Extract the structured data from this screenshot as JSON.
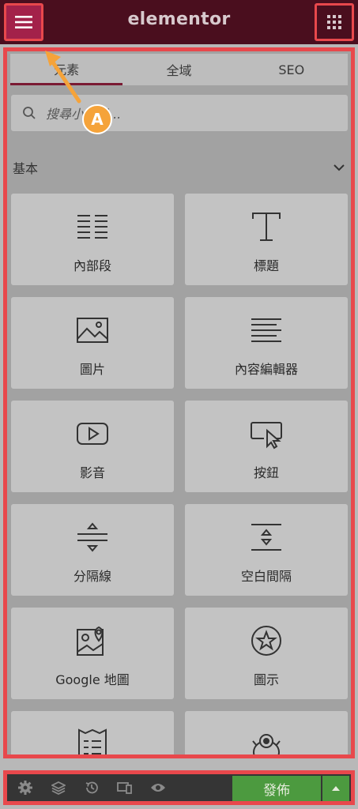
{
  "header": {
    "logo": "elementor",
    "menu_icon": "hamburger-icon",
    "apps_icon": "grid-icon"
  },
  "tabs": [
    {
      "label": "元素",
      "active": true
    },
    {
      "label": "全域",
      "active": false
    },
    {
      "label": "SEO",
      "active": false
    }
  ],
  "search": {
    "placeholder": "搜尋小工具..."
  },
  "section": {
    "title": "基本"
  },
  "widgets": [
    {
      "label": "內部段",
      "icon": "inner-section-icon"
    },
    {
      "label": "標題",
      "icon": "heading-icon"
    },
    {
      "label": "圖片",
      "icon": "image-icon"
    },
    {
      "label": "內容編輯器",
      "icon": "text-editor-icon"
    },
    {
      "label": "影音",
      "icon": "video-icon"
    },
    {
      "label": "按鈕",
      "icon": "button-icon"
    },
    {
      "label": "分隔線",
      "icon": "divider-icon"
    },
    {
      "label": "空白間隔",
      "icon": "spacer-icon"
    },
    {
      "label": "Google 地圖",
      "icon": "google-maps-icon"
    },
    {
      "label": "圖示",
      "icon": "star-icon"
    },
    {
      "label": "",
      "icon": "form-icon"
    },
    {
      "label": "",
      "icon": "monster-icon"
    }
  ],
  "annotation": {
    "badge": "A"
  },
  "footer": {
    "publish_label": "發佈",
    "icons": [
      "gear-icon",
      "layers-icon",
      "history-icon",
      "responsive-icon",
      "eye-icon"
    ]
  },
  "colors": {
    "header_bg": "#4a0e1e",
    "accent": "#a3214a",
    "highlight": "#e8484c",
    "publish": "#4c9a3f",
    "badge": "#f5a33a"
  }
}
